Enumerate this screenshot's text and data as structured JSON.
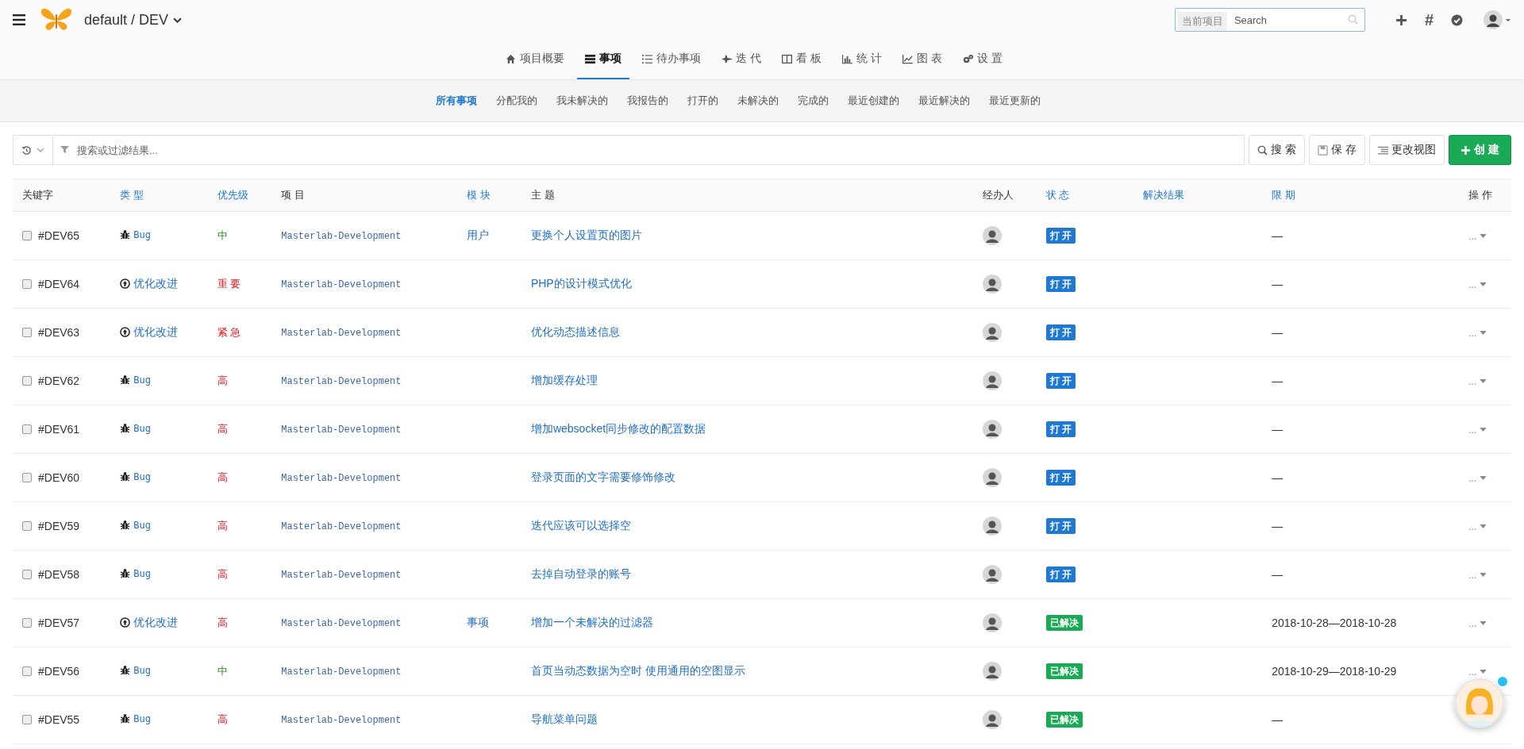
{
  "header": {
    "project": "default / DEV",
    "search": {
      "prefix": "当前项目",
      "placeholder": "Search"
    },
    "hash": "#"
  },
  "nav_tabs": [
    {
      "label": "项目概要",
      "selected": false
    },
    {
      "label": "事项",
      "selected": true
    },
    {
      "label": "待办事项",
      "selected": false
    },
    {
      "label": "迭 代",
      "selected": false
    },
    {
      "label": "看 板",
      "selected": false
    },
    {
      "label": "统 计",
      "selected": false
    },
    {
      "label": "图 表",
      "selected": false
    },
    {
      "label": "设 置",
      "selected": false
    }
  ],
  "filters": [
    {
      "label": "所有事项",
      "selected": true
    },
    {
      "label": "分配我的",
      "selected": false
    },
    {
      "label": "我未解决的",
      "selected": false
    },
    {
      "label": "我报告的",
      "selected": false
    },
    {
      "label": "打开的",
      "selected": false
    },
    {
      "label": "未解决的",
      "selected": false
    },
    {
      "label": "完成的",
      "selected": false
    },
    {
      "label": "最近创建的",
      "selected": false
    },
    {
      "label": "最近解决的",
      "selected": false
    },
    {
      "label": "最近更新的",
      "selected": false
    }
  ],
  "toolbar": {
    "placeholder": "搜索或过滤结果...",
    "buttons": [
      {
        "label": "搜 索",
        "kind": "search"
      },
      {
        "label": "保 存",
        "kind": "save"
      },
      {
        "label": "更改视图",
        "kind": "view"
      },
      {
        "label": "创 建",
        "kind": "create"
      }
    ]
  },
  "table": {
    "columns": [
      {
        "label": "关键字",
        "sortable": false
      },
      {
        "label": "类 型",
        "sortable": true
      },
      {
        "label": "优先级",
        "sortable": true
      },
      {
        "label": "项 目",
        "sortable": false
      },
      {
        "label": "模 块",
        "sortable": true
      },
      {
        "label": "主 题",
        "sortable": false
      },
      {
        "label": "经办人",
        "sortable": false
      },
      {
        "label": "状 态",
        "sortable": true
      },
      {
        "label": "解决结果",
        "sortable": true
      },
      {
        "label": "限 期",
        "sortable": true
      },
      {
        "label": "操 作",
        "sortable": false
      }
    ],
    "rows": [
      {
        "key": "#DEV65",
        "checked": false,
        "type": {
          "kind": "bug",
          "label": "Bug"
        },
        "priority": {
          "label": "中",
          "kind": "medium"
        },
        "project": "Masterlab-Development",
        "module": "用户",
        "subject": "更换个人设置页的图片",
        "status": {
          "label": "打 开",
          "color": "#1f78d1"
        },
        "deadline": "—",
        "action": "..."
      },
      {
        "key": "#DEV64",
        "checked": false,
        "type": {
          "kind": "improve",
          "label": "优化改进"
        },
        "priority": {
          "label": "重 要",
          "kind": "high"
        },
        "project": "Masterlab-Development",
        "subject": "PHP的设计模式优化",
        "status": {
          "label": "打 开",
          "color": "#1f78d1"
        },
        "deadline": "—",
        "action": "..."
      },
      {
        "key": "#DEV63",
        "checked": false,
        "type": {
          "kind": "improve",
          "label": "优化改进"
        },
        "priority": {
          "label": "紧 急",
          "kind": "high"
        },
        "project": "Masterlab-Development",
        "subject": "优化动态描述信息",
        "status": {
          "label": "打 开",
          "color": "#1f78d1"
        },
        "deadline": "—",
        "action": "..."
      },
      {
        "key": "#DEV62",
        "checked": false,
        "type": {
          "kind": "bug",
          "label": "Bug"
        },
        "priority": {
          "label": "高",
          "kind": "high"
        },
        "project": "Masterlab-Development",
        "subject": "增加缓存处理",
        "status": {
          "label": "打 开",
          "color": "#1f78d1"
        },
        "deadline": "—",
        "action": "..."
      },
      {
        "key": "#DEV61",
        "checked": false,
        "type": {
          "kind": "bug",
          "label": "Bug"
        },
        "priority": {
          "label": "高",
          "kind": "high"
        },
        "project": "Masterlab-Development",
        "subject": "增加websocket同步修改的配置数据",
        "status": {
          "label": "打 开",
          "color": "#1f78d1"
        },
        "deadline": "—",
        "action": "..."
      },
      {
        "key": "#DEV60",
        "checked": false,
        "type": {
          "kind": "bug",
          "label": "Bug"
        },
        "priority": {
          "label": "高",
          "kind": "high"
        },
        "project": "Masterlab-Development",
        "subject": "登录页面的文字需要修饰修改",
        "status": {
          "label": "打 开",
          "color": "#1f78d1"
        },
        "deadline": "—",
        "action": "..."
      },
      {
        "key": "#DEV59",
        "checked": false,
        "type": {
          "kind": "bug",
          "label": "Bug"
        },
        "priority": {
          "label": "高",
          "kind": "high"
        },
        "project": "Masterlab-Development",
        "subject": "迭代应该可以选择空",
        "status": {
          "label": "打 开",
          "color": "#1f78d1"
        },
        "deadline": "—",
        "action": "..."
      },
      {
        "key": "#DEV58",
        "checked": false,
        "type": {
          "kind": "bug",
          "label": "Bug"
        },
        "priority": {
          "label": "高",
          "kind": "high"
        },
        "project": "Masterlab-Development",
        "subject": "去掉自动登录的账号",
        "status": {
          "label": "打 开",
          "color": "#1f78d1"
        },
        "deadline": "—",
        "action": "..."
      },
      {
        "key": "#DEV57",
        "checked": false,
        "type": {
          "kind": "improve",
          "label": "优化改进"
        },
        "priority": {
          "label": "高",
          "kind": "high"
        },
        "project": "Masterlab-Development",
        "module": "事项",
        "subject": "增加一个未解决的过滤器",
        "status": {
          "label": "已解决",
          "color": "#1aaa55"
        },
        "deadline": "2018-10-28—2018-10-28",
        "action": "..."
      },
      {
        "key": "#DEV56",
        "checked": false,
        "type": {
          "kind": "bug",
          "label": "Bug"
        },
        "priority": {
          "label": "中",
          "kind": "medium"
        },
        "project": "Masterlab-Development",
        "subject": "首页当动态数据为空时 使用通用的空图显示",
        "status": {
          "label": "已解决",
          "color": "#1aaa55"
        },
        "deadline": "2018-10-29—2018-10-29",
        "action": "..."
      },
      {
        "key": "#DEV55",
        "checked": false,
        "type": {
          "kind": "bug",
          "label": "Bug"
        },
        "priority": {
          "label": "高",
          "kind": "high"
        },
        "project": "Masterlab-Development",
        "subject": "导航菜单问题",
        "status": {
          "label": "已解决",
          "color": "#1aaa55"
        },
        "deadline": "—"
      }
    ]
  }
}
